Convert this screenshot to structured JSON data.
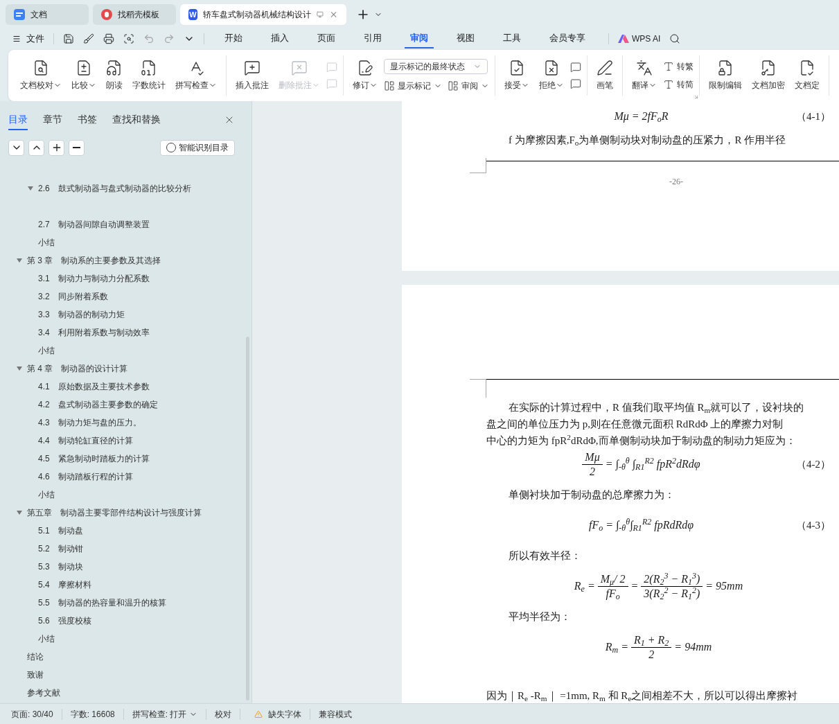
{
  "tabs": [
    {
      "kind": "docs",
      "label": "文档",
      "selected": false
    },
    {
      "kind": "template",
      "label": "找稻壳模板",
      "selected": false
    },
    {
      "kind": "writer",
      "logo": "W",
      "label": "轿车盘式制动器机械结构设计",
      "selected": true
    }
  ],
  "menu": {
    "file": "文件",
    "items": [
      {
        "label": "开始",
        "selected": false
      },
      {
        "label": "插入",
        "selected": false
      },
      {
        "label": "页面",
        "selected": false
      },
      {
        "label": "引用",
        "selected": false
      },
      {
        "label": "审阅",
        "selected": true
      },
      {
        "label": "视图",
        "selected": false
      },
      {
        "label": "工具",
        "selected": false
      },
      {
        "label": "会员专享",
        "selected": false
      }
    ],
    "ai": "WPS AI"
  },
  "ribbon": {
    "groups": [
      {
        "items": [
          {
            "kind": "big",
            "label": "文档校对",
            "caret": true,
            "disabled": false
          },
          {
            "kind": "big",
            "label": "比较",
            "caret": true,
            "disabled": false
          },
          {
            "kind": "big",
            "label": "朗读",
            "caret": false,
            "disabled": false
          },
          {
            "kind": "big",
            "label": "字数统计",
            "caret": false,
            "disabled": false
          },
          {
            "kind": "big",
            "label": "拼写检查",
            "caret": true,
            "disabled": false
          }
        ]
      },
      {
        "items": [
          {
            "kind": "big",
            "label": "插入批注",
            "caret": false,
            "disabled": false
          },
          {
            "kind": "big",
            "label": "删除批注",
            "caret": true,
            "disabled": true
          },
          {
            "kind": "stack",
            "rows": [
              [
                {
                  "kind": "small",
                  "caret": false,
                  "disabled": true
                }
              ],
              [
                {
                  "kind": "small",
                  "caret": false,
                  "disabled": true
                }
              ]
            ]
          }
        ]
      },
      {
        "items": [
          {
            "kind": "big",
            "label": "修订",
            "caret": true,
            "disabled": false
          },
          {
            "kind": "stack",
            "rows": [
              [
                {
                  "kind": "select",
                  "value": "显示标记的最终状态"
                }
              ],
              [
                {
                  "kind": "small",
                  "label": "显示标记",
                  "caret": true,
                  "disabled": false
                },
                {
                  "kind": "small",
                  "label": "审阅",
                  "caret": true,
                  "disabled": false
                }
              ]
            ]
          }
        ]
      },
      {
        "items": [
          {
            "kind": "big",
            "label": "接受",
            "caret": true,
            "disabled": false
          },
          {
            "kind": "big",
            "label": "拒绝",
            "caret": true,
            "disabled": false
          },
          {
            "kind": "stack",
            "rows": [
              [
                {
                  "kind": "small",
                  "caret": false,
                  "disabled": false
                }
              ],
              [
                {
                  "kind": "small",
                  "caret": false,
                  "disabled": false
                }
              ]
            ]
          }
        ]
      },
      {
        "items": [
          {
            "kind": "big",
            "label": "画笔",
            "caret": false,
            "disabled": false
          }
        ]
      },
      {
        "launcher": true,
        "items": [
          {
            "kind": "big",
            "label": "翻译",
            "caret": true,
            "disabled": false
          },
          {
            "kind": "stack",
            "rows": [
              [
                {
                  "kind": "small",
                  "label": "转繁",
                  "caret": false,
                  "disabled": false
                }
              ],
              [
                {
                  "kind": "small",
                  "label": "转简",
                  "caret": false,
                  "disabled": false
                }
              ]
            ]
          }
        ]
      },
      {
        "items": [
          {
            "kind": "big",
            "label": "限制编辑",
            "caret": false,
            "disabled": false
          },
          {
            "kind": "big",
            "label": "文档加密",
            "caret": false,
            "disabled": false
          },
          {
            "kind": "big",
            "label": "文档定",
            "caret": false,
            "disabled": false
          }
        ]
      }
    ]
  },
  "sidebar": {
    "tabs": [
      {
        "label": "目录",
        "selected": true
      },
      {
        "label": "章节",
        "selected": false
      },
      {
        "label": "书签",
        "selected": false
      },
      {
        "label": "查找和替换",
        "selected": false
      }
    ],
    "smart_button": "智能识别目录",
    "toc": {
      "continued": [
        {
          "number": "2.6",
          "title": "鼓式制动器与盘式制动器的比较分析",
          "expanded": true
        },
        {
          "number": "2.7",
          "title": "制动器间隙自动调整装置"
        },
        {
          "title": "小结"
        }
      ],
      "items": [
        {
          "number": "第 3 章",
          "title": "制动系的主要参数及其选择",
          "expanded": true,
          "children": [
            {
              "number": "3.1",
              "title": "制动力与制动力分配系数"
            },
            {
              "number": "3.2",
              "title": "同步附着系数"
            },
            {
              "number": "3.3",
              "title": "制动器的制动力矩"
            },
            {
              "number": "3.4",
              "title": "利用附着系数与制动效率"
            },
            {
              "title": "小结"
            }
          ]
        },
        {
          "number": "第 4 章",
          "title": "制动器的设计计算",
          "expanded": true,
          "children": [
            {
              "number": "4.1",
              "title": "原始数据及主要技术参数"
            },
            {
              "number": "4.2",
              "title": "盘式制动器主要参数的确定"
            },
            {
              "number": "4.3",
              "title": "制动力矩与盘的压力。"
            },
            {
              "number": "4.4",
              "title": "制动轮缸直径的计算"
            },
            {
              "number": "4.5",
              "title": "紧急制动时踏板力的计算"
            },
            {
              "number": "4.6",
              "title": "制动踏板行程的计算"
            },
            {
              "title": "小结"
            }
          ]
        },
        {
          "number": "第五章",
          "title": "制动器主要零部件结构设计与强度计算",
          "expanded": true,
          "children": [
            {
              "number": "5.1",
              "title": "制动盘"
            },
            {
              "number": "5.2",
              "title": "制动钳"
            },
            {
              "number": "5.3",
              "title": "制动块"
            },
            {
              "number": "5.4",
              "title": "摩擦材料"
            },
            {
              "number": "5.5",
              "title": "制动器的热容量和温升的核算"
            },
            {
              "number": "5.6",
              "title": "强度校核"
            },
            {
              "title": "小结"
            }
          ]
        },
        {
          "title": "结论"
        },
        {
          "title": "致谢"
        },
        {
          "title": "参考文献"
        }
      ]
    }
  },
  "document": {
    "pages": [
      {
        "blocks": [
          {
            "kind": "formula",
            "parts": [
              {
                "kind": "text",
                "text": "Mμ = 2fF$_{o}$R"
              }
            ],
            "number": "（4-1）"
          },
          {
            "kind": "para",
            "indent": true,
            "lines": [
              "f 为摩擦因素,F$_{o}$为单侧制动块对制动盘的压紧力，R 作用半径"
            ]
          }
        ],
        "page_number": "-26-"
      },
      {
        "blocks": [
          {
            "kind": "para",
            "indent": true,
            "lines": [
              "在实际的计算过程中，R 值我们取平均值 R$_{m}$就可以了，设衬块的",
              "盘之间的单位压力为 p,则在任意微元面积 RdRdΦ 上的摩擦力对制",
              "中心的力矩为 fpR$^{2}$dRdΦ,而单侧制动块加于制动盘的制动力矩应为："
            ]
          },
          {
            "kind": "formula",
            "parts": [
              {
                "kind": "frac",
                "num": "Mμ",
                "den": "2"
              },
              {
                "kind": "text",
                "text": "= ∫$_{-θ}$$^{θ}$ ∫$_{R1}$$^{R2}$ fpR$^{2}$dRdφ"
              }
            ],
            "number": "（4-2）"
          },
          {
            "kind": "para",
            "indent": true,
            "lines": [
              "单侧衬块加于制动盘的总摩擦力为："
            ]
          },
          {
            "kind": "formula",
            "parts": [
              {
                "kind": "text",
                "text": "fF$_{o}$ = ∫$_{-θ}$$^{θ}$∫$_{R1}$$^{R2}$ fpRdRdφ"
              }
            ],
            "number": "（4-3）"
          },
          {
            "kind": "para",
            "indent": true,
            "lines": [
              "所以有效半径："
            ]
          },
          {
            "kind": "formula",
            "parts": [
              {
                "kind": "text",
                "text": "R$_{e}$ ="
              },
              {
                "kind": "frac",
                "num": "M$_{μ}$/ 2",
                "den": "fF$_{o}$"
              },
              {
                "kind": "text",
                "text": "="
              },
              {
                "kind": "frac",
                "num": "2(R$_{2}$$^{3}$ − R$_{1}$$^{3}$)",
                "den": "3(R$_{2}$$^{2}$ − R$_{1}$$^{2}$)"
              },
              {
                "kind": "text",
                "text": "= 95mm"
              }
            ]
          },
          {
            "kind": "para",
            "indent": true,
            "lines": [
              "平均半径为："
            ]
          },
          {
            "kind": "formula",
            "parts": [
              {
                "kind": "text",
                "text": "R$_{m}$ ="
              },
              {
                "kind": "frac",
                "num": "R$_{1}$ + R$_{2}$",
                "den": "2"
              },
              {
                "kind": "text",
                "text": "= 94mm"
              }
            ]
          },
          {
            "kind": "para",
            "indent": false,
            "lines": [
              "因为｜R$_{e}$ -R$_{m}$｜ =1mm, R$_{m}$ 和 R$_{e}$之间相差不大，所以可以得出摩擦衬"
            ]
          }
        ]
      }
    ]
  },
  "status_bar": {
    "page": "页面: 30/40",
    "words": "字数: 16608",
    "spell": "拼写检查: 打开",
    "proof": "校对",
    "missing_font": "缺失字体",
    "compat": "兼容模式"
  }
}
